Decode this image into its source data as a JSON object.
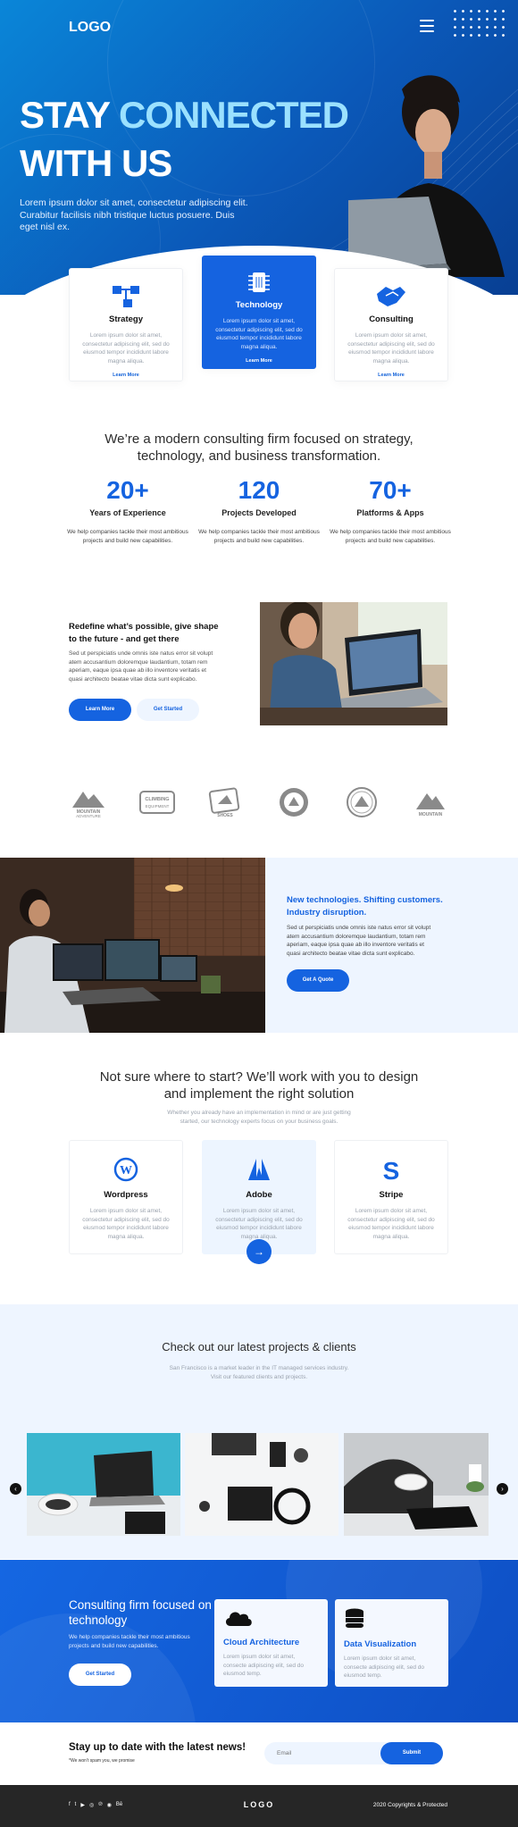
{
  "header": {
    "logo": "LOGO"
  },
  "hero": {
    "title_white": "STAY ",
    "title_accent": "CONNECTED",
    "title_line2": "WITH US",
    "subtitle": "Lorem ipsum dolor sit amet, consectetur adipiscing elit. Curabitur facilisis nibh tristique luctus posuere. Duis eget nisl ex."
  },
  "services": [
    {
      "title": "Strategy",
      "text": "Lorem ipsum dolor sit amet, consectetur adipiscing elit, sed do eiusmod tempor incididunt labore magna aliqua.",
      "link": "Learn More"
    },
    {
      "title": "Technology",
      "text": "Lorem ipsum dolor sit amet, consectetur adipiscing elit, sed do eiusmod tempor incididunt labore magna aliqua.",
      "link": "Learn More"
    },
    {
      "title": "Consulting",
      "text": "Lorem ipsum dolor sit amet, consectetur adipiscing elit, sed do eiusmod tempor incididunt labore magna aliqua.",
      "link": "Learn More"
    }
  ],
  "intro": {
    "line1": "We’re a modern consulting firm focused on strategy,",
    "line2": "technology, and business transformation."
  },
  "stats": [
    {
      "number": "20+",
      "label": "Years of Experience",
      "text": "We help companies tackle their most ambitious projects and build new capabilities."
    },
    {
      "number": "120",
      "label": "Projects Developed",
      "text": "We help companies tackle their most ambitious projects and build new capabilities."
    },
    {
      "number": "70+",
      "label": "Platforms & Apps",
      "text": "We help companies tackle their most ambitious projects and build new capabilities."
    }
  ],
  "redefine": {
    "title": "Redefine what’s possible, give shape to the future - and get there",
    "text": "Sed ut perspiciatis unde omnis iste natus error sit volupt atem accusantium doloremque laudantium, totam rem aperiam, eaque ipsa quae ab illo inventore veritatis et quasi architecto beatae vitae dicta sunt explicabo.",
    "btn_primary": "Learn More",
    "btn_secondary": "Get Started"
  },
  "brands": [
    "MOUNTAIN ADVENTURE",
    "CLIMBING EQUIPMENT",
    "HIKING SHOES",
    "OUTDOOR",
    "MOUNTAIN",
    "MOUNTAIN CAMP"
  ],
  "newtech": {
    "title": "New technologies. Shifting customers. Industry disruption.",
    "text": "Sed ut perspiciatis unde omnis iste natus error sit volupt atem accusantium doloremque laudantium, totam rem aperiam, eaque ipsa quae ab illo inventore veritatis et quasi architecto beatae vitae dicta sunt explicabo.",
    "button": "Get A Quote"
  },
  "start": {
    "title1": "Not sure where to start? We’ll work with you to design",
    "title2": "and implement the right solution",
    "sub1": "Whether you already have an implementation in mind or are just getting",
    "sub2": "started, our technology experts focus on your business goals."
  },
  "platforms": [
    {
      "title": "Wordpress",
      "text": "Lorem ipsum dolor sit amet, consectetur adipiscing elit, sed do eiusmod tempor incididunt labore magna aliqua."
    },
    {
      "title": "Adobe",
      "text": "Lorem ipsum dolor sit amet, consectetur adipiscing elit, sed do eiusmod tempor incididunt labore magna aliqua."
    },
    {
      "title": "Stripe",
      "text": "Lorem ipsum dolor sit amet, consectetur adipiscing elit, sed do eiusmod tempor incididunt labore magna aliqua."
    }
  ],
  "projects": {
    "title": "Check out our latest projects & clients",
    "sub1": "San Francisco is a market leader in the IT managed services industry.",
    "sub2": "Visit our featured clients and projects."
  },
  "band": {
    "title": "Consulting firm focused on technology",
    "text": "We help companies tackle their most ambitious projects and build new capabilities.",
    "button": "Get Started",
    "cards": [
      {
        "title": "Cloud Architecture",
        "text": "Lorem ipsum dolor sit amet, consecte adipiscing elit, sed do eiusmod temp."
      },
      {
        "title": "Data Visualization",
        "text": "Lorem ipsum dolor sit amet, consecte adipiscing elit, sed do eiusmod temp."
      }
    ]
  },
  "newsletter": {
    "title": "Stay up to date with the latest news!",
    "note": "*We won’t spam you, we promise",
    "placeholder": "Email",
    "button": "Submit"
  },
  "footer": {
    "logo": "LOGO",
    "copyright": "2020 Copyrights & Protected",
    "social": [
      "f",
      "t",
      "▶",
      "◎",
      "℗",
      "◉",
      "Bē"
    ]
  },
  "colors": {
    "primary": "#1563e0",
    "light": "#eef5ff",
    "dark": "#262626"
  }
}
